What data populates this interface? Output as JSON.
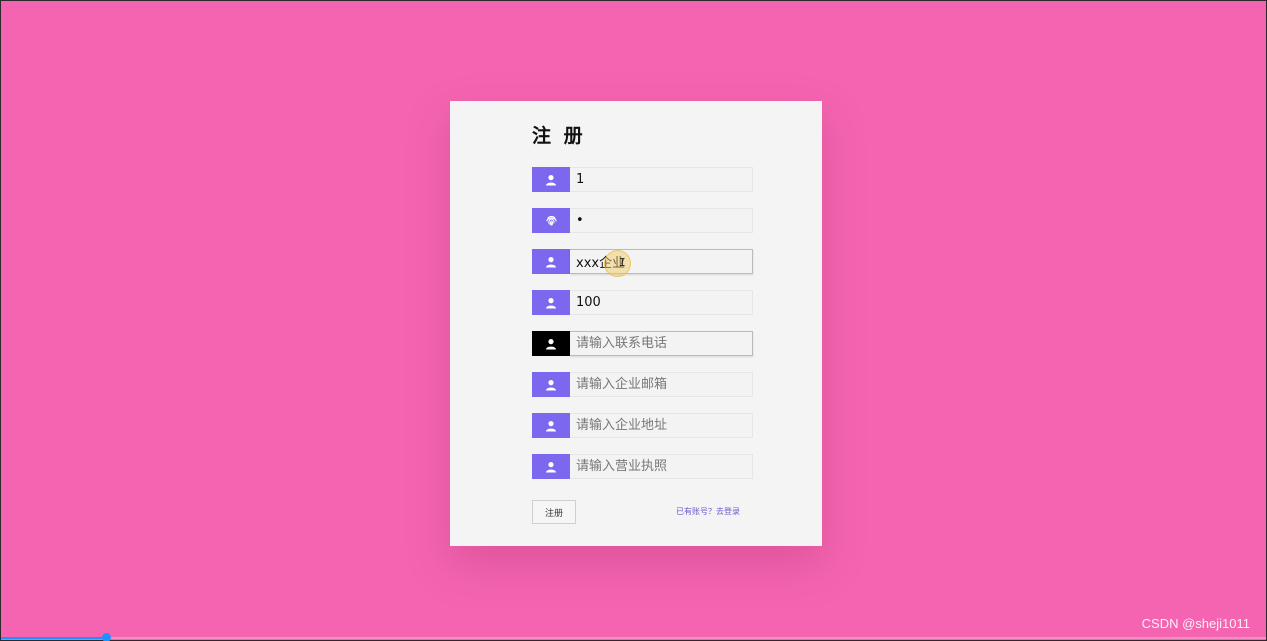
{
  "form": {
    "title": "注 册",
    "fields": [
      {
        "name": "username",
        "icon": "user-icon",
        "value": "1",
        "placeholder": ""
      },
      {
        "name": "password",
        "icon": "fingerprint-icon",
        "value": "•",
        "placeholder": ""
      },
      {
        "name": "company-name",
        "icon": "user-icon",
        "value": "xxx企业",
        "placeholder": ""
      },
      {
        "name": "quantity",
        "icon": "user-icon",
        "value": "100",
        "placeholder": ""
      },
      {
        "name": "phone",
        "icon": "user-icon",
        "value": "",
        "placeholder": "请输入联系电话"
      },
      {
        "name": "email",
        "icon": "user-icon",
        "value": "",
        "placeholder": "请输入企业邮箱"
      },
      {
        "name": "address",
        "icon": "user-icon",
        "value": "",
        "placeholder": "请输入企业地址"
      },
      {
        "name": "license",
        "icon": "user-icon",
        "value": "",
        "placeholder": "请输入营业执照"
      }
    ],
    "submit_label": "注册",
    "login_link": "已有账号？去登录"
  },
  "colors": {
    "background": "#f564b0",
    "card": "#f4f4f4",
    "icon_box": "#7b68ee",
    "icon_box_active": "#000000",
    "link": "#6a5acd"
  },
  "watermark": "CSDN @sheji1011",
  "video_progress": 0.083
}
